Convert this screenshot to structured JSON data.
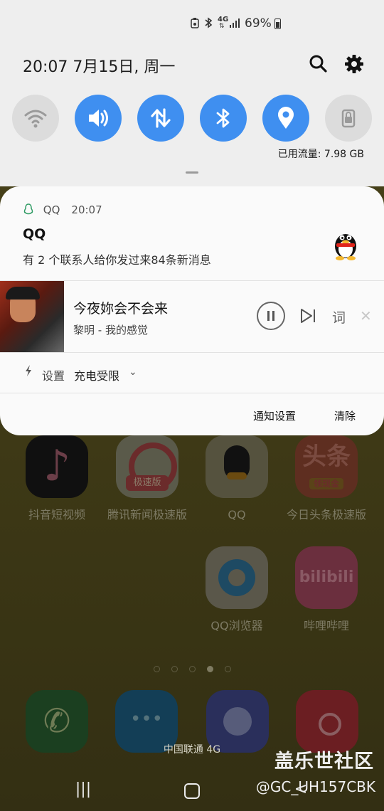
{
  "status_bar": {
    "network": "4G",
    "battery_percent": "69%",
    "battery_level": 0.69
  },
  "header": {
    "datetime": "20:07  7月15日, 周一",
    "search_icon": "search-icon",
    "settings_icon": "gear-icon"
  },
  "quick_settings": {
    "tiles": [
      {
        "name": "wifi",
        "active": false
      },
      {
        "name": "sound",
        "active": true
      },
      {
        "name": "mobile-data",
        "active": true
      },
      {
        "name": "bluetooth",
        "active": true
      },
      {
        "name": "location",
        "active": true
      },
      {
        "name": "lock-screen",
        "active": false
      }
    ],
    "data_usage": "已用流量: 7.98 GB",
    "accent_color": "#3f8ff0"
  },
  "notification": {
    "app_name": "QQ",
    "time": "20:07",
    "title": "QQ",
    "text": "有 2 个联系人给你发过来84条新消息"
  },
  "media": {
    "song": "今夜妳会不会来",
    "artist": "黎明 - 我的感觉",
    "lyrics_label": "词",
    "close_glyph": "✕"
  },
  "system_setting": {
    "label": "设置",
    "value": "充电受限",
    "chevron": "⌄"
  },
  "actions": {
    "notification_settings": "通知设置",
    "clear": "清除"
  },
  "home_screen": {
    "apps": [
      {
        "label": "抖音短视频"
      },
      {
        "label": "腾讯新闻极速版",
        "tag": "极速版"
      },
      {
        "label": "QQ"
      },
      {
        "label": "今日头条极速版",
        "icon_text": "头条",
        "sub": "领现金"
      },
      {
        "label": "QQ浏览器"
      },
      {
        "label": "哔哩哔哩",
        "icon_text": "bilibili"
      }
    ],
    "carrier": "中国联通 4G"
  },
  "navbar": {
    "recent": "|||",
    "back": "<"
  },
  "watermark": {
    "line1": "盖乐世社区",
    "line2": "@GC_UH157CBK"
  }
}
